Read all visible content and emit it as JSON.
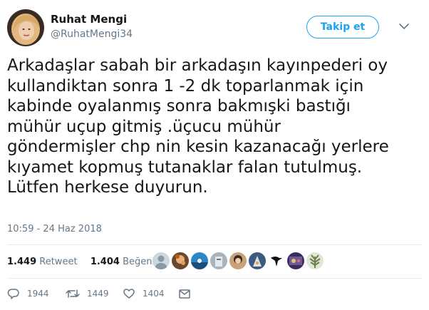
{
  "author": {
    "display_name": "Ruhat Mengi",
    "handle": "@RuhatMengi34",
    "avatar_icon": "profile-photo"
  },
  "follow_button": {
    "label": "Takip et"
  },
  "menu": {
    "icon": "chevron-down-icon"
  },
  "tweet": {
    "text": "Arkadaşlar sabah bir arkadaşın kayınpederi oy\nkullandiktan sonra 1 -2 dk toparlanmak için\nkabinde oyalanmış sonra bakmışki bastığı\nmühür uçup gitmiş .üçucu mühür\ngöndermişler chp nin kesin kazanacağı yerlere\nkıyamet kopmuş tutanaklar falan tutulmuş.\nLütfen herkese duyurun.",
    "timestamp": "10:59 - 24 Haz 2018"
  },
  "stats": {
    "retweets_count": "1.449",
    "retweets_label": "Retweet",
    "likes_count": "1.404",
    "likes_label": "Beğeni"
  },
  "liker_avatars": [
    {
      "icon": "default-avatar",
      "color": "#ccd6dd"
    },
    {
      "icon": "user-photo",
      "color": "#6b4a2b"
    },
    {
      "icon": "user-photo",
      "color": "#2b87c8"
    },
    {
      "icon": "user-photo",
      "color": "#a7b3bd"
    },
    {
      "icon": "user-photo",
      "color": "#c9a27a"
    },
    {
      "icon": "user-photo",
      "color": "#3d5a80"
    },
    {
      "icon": "user-photo",
      "color": "#111111"
    },
    {
      "icon": "user-photo",
      "color": "#3b2d5a"
    },
    {
      "icon": "user-photo",
      "color": "#6e7f4a"
    }
  ],
  "actions": {
    "reply_count": "1944",
    "retweet_count": "1449",
    "like_count": "1404"
  },
  "colors": {
    "accent": "#1da1f2",
    "text_primary": "#14171a",
    "text_secondary": "#657786",
    "divider": "#e6ecf0"
  }
}
